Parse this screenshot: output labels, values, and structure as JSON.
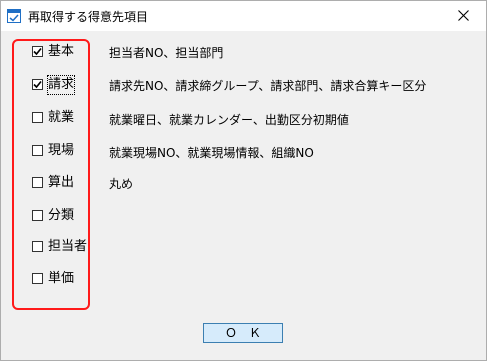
{
  "window": {
    "title": "再取得する得意先項目"
  },
  "items": [
    {
      "label": "基本",
      "checked": true,
      "description": "担当者NO、担当部門"
    },
    {
      "label": "請求",
      "checked": true,
      "description": "請求先NO、請求締グループ、請求部門、請求合算キー区分"
    },
    {
      "label": "就業",
      "checked": false,
      "description": "就業曜日、就業カレンダー、出勤区分初期値"
    },
    {
      "label": "現場",
      "checked": false,
      "description": "就業現場NO、就業現場情報、組織NO"
    },
    {
      "label": "算出",
      "checked": false,
      "description": "丸め"
    },
    {
      "label": "分類",
      "checked": false,
      "description": ""
    },
    {
      "label": "担当者",
      "checked": false,
      "description": ""
    },
    {
      "label": "単価",
      "checked": false,
      "description": ""
    }
  ],
  "footer": {
    "ok_label": "Ｏ　Ｋ"
  },
  "colors": {
    "highlight_border": "#ff1a1a",
    "ok_button_bg": "#d6ebfb",
    "ok_button_border": "#3c7fb1"
  },
  "icons": {
    "app": "app-window-icon",
    "close": "close-icon",
    "check": "check-icon"
  }
}
